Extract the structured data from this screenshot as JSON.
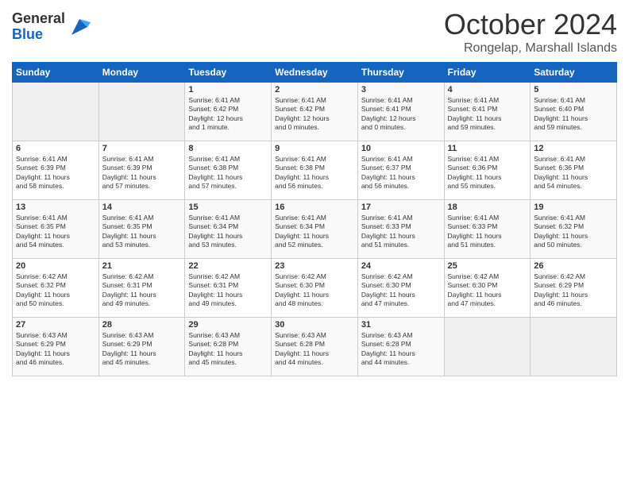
{
  "logo": {
    "general": "General",
    "blue": "Blue"
  },
  "title": "October 2024",
  "location": "Rongelap, Marshall Islands",
  "days_of_week": [
    "Sunday",
    "Monday",
    "Tuesday",
    "Wednesday",
    "Thursday",
    "Friday",
    "Saturday"
  ],
  "weeks": [
    [
      {
        "day": "",
        "content": ""
      },
      {
        "day": "",
        "content": ""
      },
      {
        "day": "1",
        "content": "Sunrise: 6:41 AM\nSunset: 6:42 PM\nDaylight: 12 hours\nand 1 minute."
      },
      {
        "day": "2",
        "content": "Sunrise: 6:41 AM\nSunset: 6:42 PM\nDaylight: 12 hours\nand 0 minutes."
      },
      {
        "day": "3",
        "content": "Sunrise: 6:41 AM\nSunset: 6:41 PM\nDaylight: 12 hours\nand 0 minutes."
      },
      {
        "day": "4",
        "content": "Sunrise: 6:41 AM\nSunset: 6:41 PM\nDaylight: 11 hours\nand 59 minutes."
      },
      {
        "day": "5",
        "content": "Sunrise: 6:41 AM\nSunset: 6:40 PM\nDaylight: 11 hours\nand 59 minutes."
      }
    ],
    [
      {
        "day": "6",
        "content": "Sunrise: 6:41 AM\nSunset: 6:39 PM\nDaylight: 11 hours\nand 58 minutes."
      },
      {
        "day": "7",
        "content": "Sunrise: 6:41 AM\nSunset: 6:39 PM\nDaylight: 11 hours\nand 57 minutes."
      },
      {
        "day": "8",
        "content": "Sunrise: 6:41 AM\nSunset: 6:38 PM\nDaylight: 11 hours\nand 57 minutes."
      },
      {
        "day": "9",
        "content": "Sunrise: 6:41 AM\nSunset: 6:38 PM\nDaylight: 11 hours\nand 56 minutes."
      },
      {
        "day": "10",
        "content": "Sunrise: 6:41 AM\nSunset: 6:37 PM\nDaylight: 11 hours\nand 56 minutes."
      },
      {
        "day": "11",
        "content": "Sunrise: 6:41 AM\nSunset: 6:36 PM\nDaylight: 11 hours\nand 55 minutes."
      },
      {
        "day": "12",
        "content": "Sunrise: 6:41 AM\nSunset: 6:36 PM\nDaylight: 11 hours\nand 54 minutes."
      }
    ],
    [
      {
        "day": "13",
        "content": "Sunrise: 6:41 AM\nSunset: 6:35 PM\nDaylight: 11 hours\nand 54 minutes."
      },
      {
        "day": "14",
        "content": "Sunrise: 6:41 AM\nSunset: 6:35 PM\nDaylight: 11 hours\nand 53 minutes."
      },
      {
        "day": "15",
        "content": "Sunrise: 6:41 AM\nSunset: 6:34 PM\nDaylight: 11 hours\nand 53 minutes."
      },
      {
        "day": "16",
        "content": "Sunrise: 6:41 AM\nSunset: 6:34 PM\nDaylight: 11 hours\nand 52 minutes."
      },
      {
        "day": "17",
        "content": "Sunrise: 6:41 AM\nSunset: 6:33 PM\nDaylight: 11 hours\nand 51 minutes."
      },
      {
        "day": "18",
        "content": "Sunrise: 6:41 AM\nSunset: 6:33 PM\nDaylight: 11 hours\nand 51 minutes."
      },
      {
        "day": "19",
        "content": "Sunrise: 6:41 AM\nSunset: 6:32 PM\nDaylight: 11 hours\nand 50 minutes."
      }
    ],
    [
      {
        "day": "20",
        "content": "Sunrise: 6:42 AM\nSunset: 6:32 PM\nDaylight: 11 hours\nand 50 minutes."
      },
      {
        "day": "21",
        "content": "Sunrise: 6:42 AM\nSunset: 6:31 PM\nDaylight: 11 hours\nand 49 minutes."
      },
      {
        "day": "22",
        "content": "Sunrise: 6:42 AM\nSunset: 6:31 PM\nDaylight: 11 hours\nand 49 minutes."
      },
      {
        "day": "23",
        "content": "Sunrise: 6:42 AM\nSunset: 6:30 PM\nDaylight: 11 hours\nand 48 minutes."
      },
      {
        "day": "24",
        "content": "Sunrise: 6:42 AM\nSunset: 6:30 PM\nDaylight: 11 hours\nand 47 minutes."
      },
      {
        "day": "25",
        "content": "Sunrise: 6:42 AM\nSunset: 6:30 PM\nDaylight: 11 hours\nand 47 minutes."
      },
      {
        "day": "26",
        "content": "Sunrise: 6:42 AM\nSunset: 6:29 PM\nDaylight: 11 hours\nand 46 minutes."
      }
    ],
    [
      {
        "day": "27",
        "content": "Sunrise: 6:43 AM\nSunset: 6:29 PM\nDaylight: 11 hours\nand 46 minutes."
      },
      {
        "day": "28",
        "content": "Sunrise: 6:43 AM\nSunset: 6:29 PM\nDaylight: 11 hours\nand 45 minutes."
      },
      {
        "day": "29",
        "content": "Sunrise: 6:43 AM\nSunset: 6:28 PM\nDaylight: 11 hours\nand 45 minutes."
      },
      {
        "day": "30",
        "content": "Sunrise: 6:43 AM\nSunset: 6:28 PM\nDaylight: 11 hours\nand 44 minutes."
      },
      {
        "day": "31",
        "content": "Sunrise: 6:43 AM\nSunset: 6:28 PM\nDaylight: 11 hours\nand 44 minutes."
      },
      {
        "day": "",
        "content": ""
      },
      {
        "day": "",
        "content": ""
      }
    ]
  ]
}
